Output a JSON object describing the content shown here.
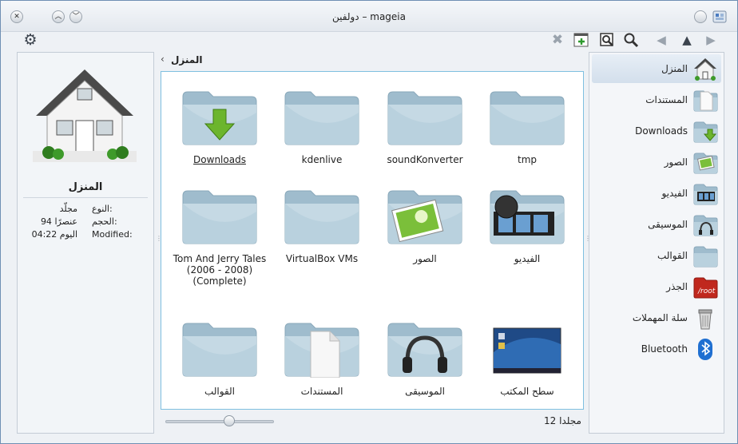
{
  "window": {
    "title": "دولفين – mageia"
  },
  "toolbar": {
    "settings_icon": "gear-icon",
    "close_icon": "close-icon",
    "new_window_icon": "new-tab-icon",
    "preview_icon": "preview-icon",
    "search_icon": "search-icon",
    "back_icon": "back-arrow-icon",
    "up_icon": "up-arrow-icon",
    "forward_icon": "forward-arrow-icon"
  },
  "breadcrumb": {
    "label": "المنزل"
  },
  "info_panel": {
    "title": "المنزل",
    "rows": [
      {
        "key": "النوع:",
        "value": "مجلّد"
      },
      {
        "key": "الحجم:",
        "value": "94 عنصرًا"
      },
      {
        "key": "Modified:",
        "value": "اليوم 04:22"
      }
    ]
  },
  "files": [
    {
      "name": "Downloads",
      "overlay": "download-arrow"
    },
    {
      "name": "kdenlive",
      "overlay": ""
    },
    {
      "name": "soundKonverter",
      "overlay": ""
    },
    {
      "name": "tmp",
      "overlay": ""
    },
    {
      "name": "Tom And Jerry Tales (2006 - 2008) (Complete)",
      "overlay": ""
    },
    {
      "name": "VirtualBox VMs",
      "overlay": ""
    },
    {
      "name": "الصور",
      "overlay": "pictures"
    },
    {
      "name": "الفيديو",
      "overlay": "film"
    },
    {
      "name": "القوالب",
      "overlay": ""
    },
    {
      "name": "المستندات",
      "overlay": "document"
    },
    {
      "name": "الموسيقى",
      "overlay": "headphones"
    },
    {
      "name": "سطح المكتب",
      "overlay": "desktop"
    }
  ],
  "places": [
    {
      "label": "المنزل",
      "icon": "home-icon",
      "selected": true
    },
    {
      "label": "المستندات",
      "icon": "documents-folder-icon"
    },
    {
      "label": "Downloads",
      "icon": "downloads-folder-icon"
    },
    {
      "label": "الصور",
      "icon": "pictures-folder-icon"
    },
    {
      "label": "الفيديو",
      "icon": "videos-folder-icon"
    },
    {
      "label": "الموسيقى",
      "icon": "music-folder-icon"
    },
    {
      "label": "القوالب",
      "icon": "templates-folder-icon"
    },
    {
      "label": "الجذر",
      "icon": "root-folder-icon"
    },
    {
      "label": "سلة المهملات",
      "icon": "trash-icon"
    },
    {
      "label": "Bluetooth",
      "icon": "bluetooth-icon"
    }
  ],
  "status": {
    "text": "12 مجلدا",
    "zoom_level": 0.6
  },
  "colors": {
    "accent": "#7fbfe0",
    "folder": "#a9c4d4",
    "download_green": "#6cb52d",
    "root_red": "#c0281e",
    "bluetooth_blue": "#1f6fd1"
  }
}
